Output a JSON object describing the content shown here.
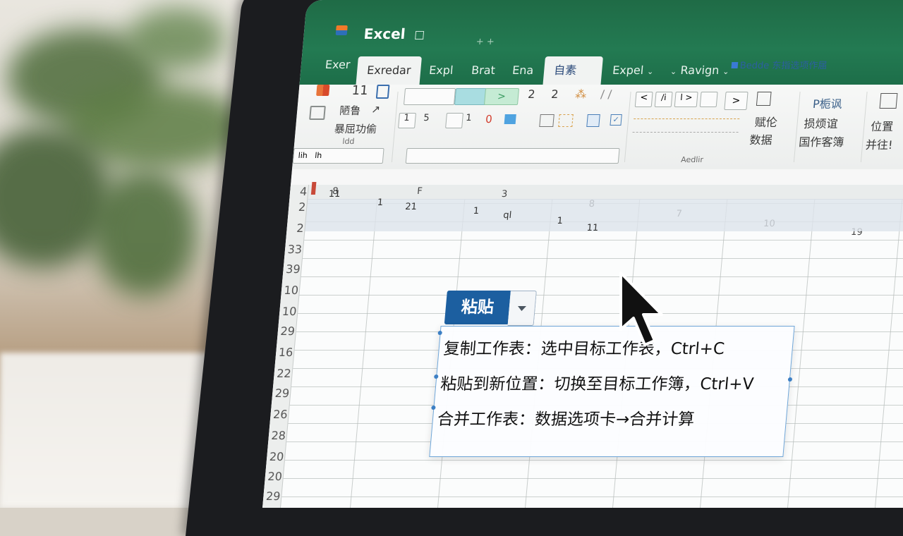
{
  "window": {
    "app_title": "Excel",
    "document_title": "Bedde 东指选项作届"
  },
  "tabs": [
    {
      "label": "Exer"
    },
    {
      "label": "Exredar"
    },
    {
      "label": "Expl"
    },
    {
      "label": "Brat"
    },
    {
      "label": "Ena"
    },
    {
      "label": "自素"
    },
    {
      "label": "Expel"
    },
    {
      "label": "Ravign"
    }
  ],
  "ribbon": {
    "num_11": "11",
    "jian_label": "陋鲁",
    "func_label": "暴屈功偷",
    "num_2a": "2",
    "num_2b": "2",
    "cell_1": "1",
    "cell_5": "5",
    "cell_1b": "1",
    "cell_0": "0",
    "analysis_label": "赋伦",
    "data_label": "数据",
    "pos_label": "位置",
    "merge_label": "并往!",
    "tool_label1": "P栀讽",
    "tool_label2": "损烦谊",
    "tool_label3": "国作客簿",
    "group_label": "Aedlir"
  },
  "grid": {
    "columns": [
      "8",
      "F",
      "3",
      "8",
      "7",
      "10",
      "19"
    ],
    "row_numbers": [
      "4",
      "2",
      "2",
      "33",
      "39",
      "10",
      "10",
      "29",
      "16",
      "22",
      "29",
      "26",
      "28",
      "20",
      "20",
      "29"
    ],
    "row1_values": [
      "11",
      "21",
      "1",
      "1",
      "ql",
      "1",
      "11"
    ]
  },
  "paste_popup": {
    "button_label": "粘贴",
    "lines": [
      "复制工作表：选中目标工作表，Ctrl+C",
      "粘贴到新位置：切换至目标工作簿，Ctrl+V",
      "合并工作表：数据选项卡→合并计算"
    ]
  },
  "colors": {
    "title_bar": "#237a52",
    "paste_button": "#1c5fa0",
    "tooltip_border": "#6fa6d8"
  }
}
